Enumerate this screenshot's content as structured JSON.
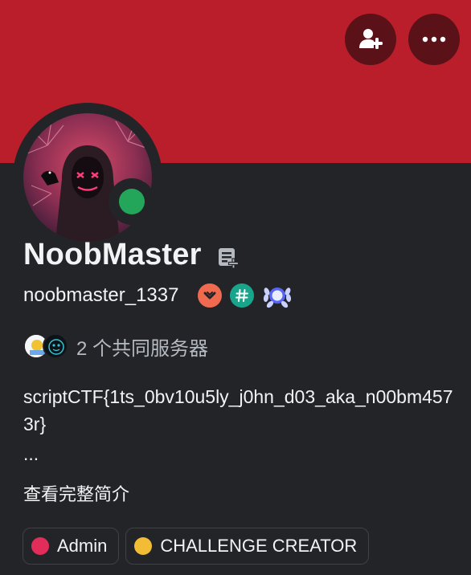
{
  "profile": {
    "display_name": "NoobMaster",
    "username": "noobmaster_1337",
    "mutual_servers_text": "2 个共同服务器",
    "bio_text": "scriptCTF{1ts_0bv10u5ly_j0hn_d03_aka_n00bm4573r}",
    "bio_ellipsis": "...",
    "view_full_profile": "查看完整简介",
    "status": "online",
    "banner_color": "#bb1e2b",
    "status_color": "#23a55a"
  },
  "header_buttons": {
    "add_friend_icon": "add-friend-icon",
    "more_icon": "more-options-icon"
  },
  "badges": [
    {
      "icon": "bug-hunter-badge-icon",
      "color": "#ef6a4f"
    },
    {
      "icon": "hashtag-badge-icon",
      "color": "#18a58c"
    },
    {
      "icon": "laurel-wreath-badge-icon",
      "color": "#a7b4ff"
    }
  ],
  "roles": [
    {
      "name": "Admin",
      "color": "#e22d5b"
    },
    {
      "name": "CHALLENGE CREATOR",
      "color": "#f2bd35"
    }
  ]
}
